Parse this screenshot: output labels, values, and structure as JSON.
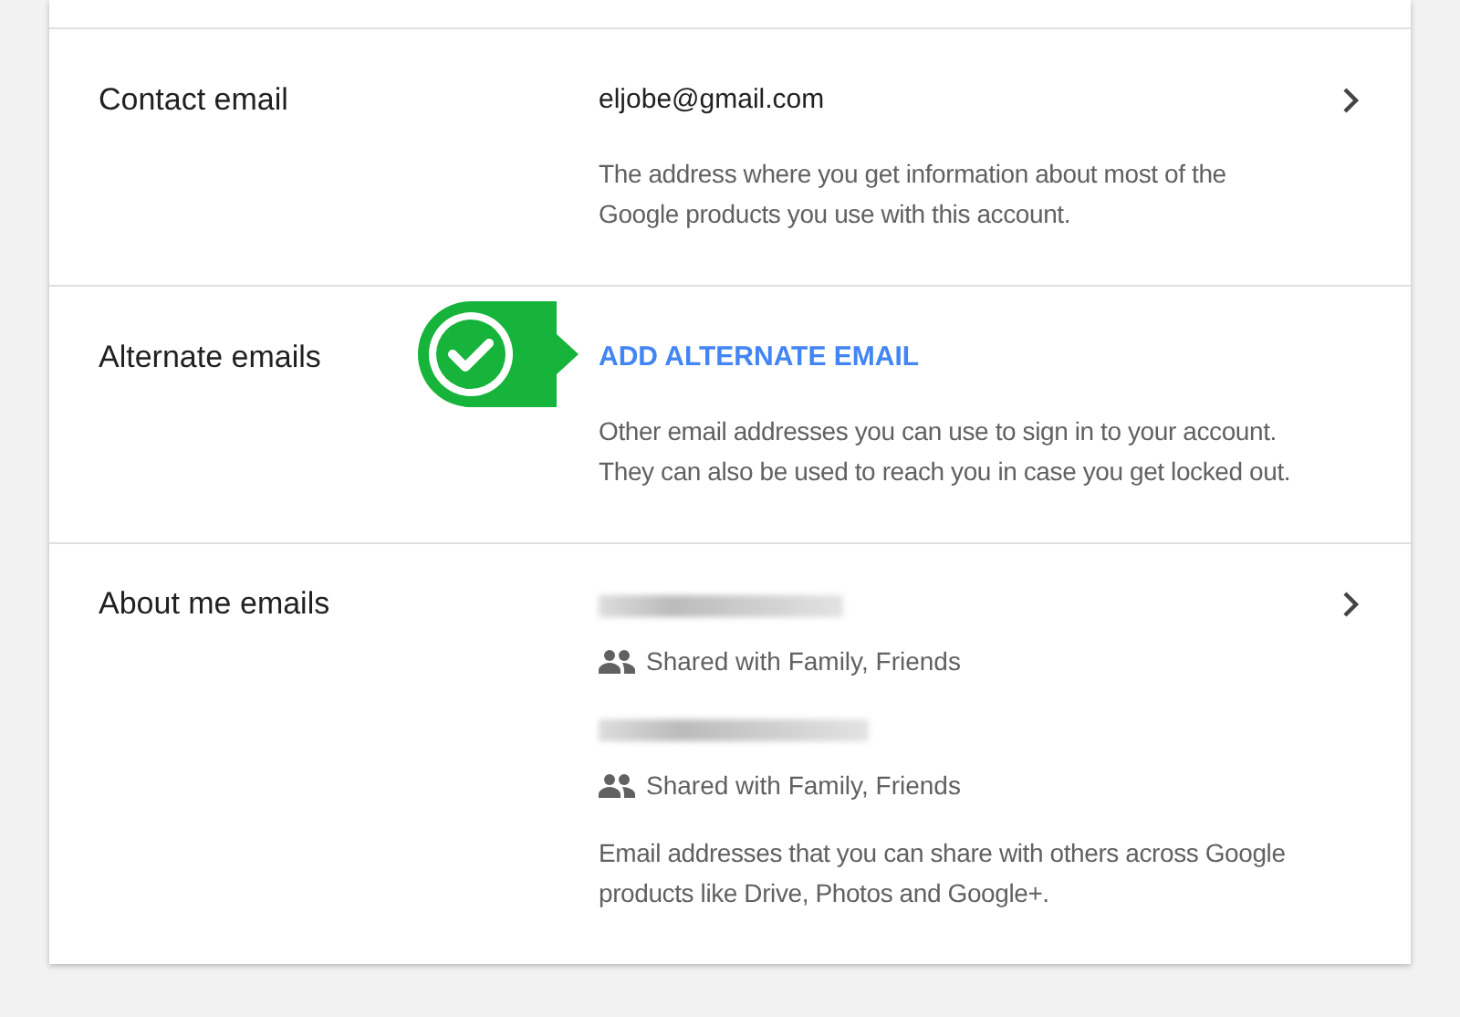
{
  "sections": [
    {
      "kind": "value",
      "label": "Contact email",
      "value": "eljobe@gmail.com",
      "description": "The address where you get information about most of the Google products you use with this account.",
      "chevron": true,
      "callout": false
    },
    {
      "kind": "action",
      "label": "Alternate emails",
      "action": "ADD ALTERNATE EMAIL",
      "description": "Other email addresses you can use to sign in to your account. They can also be used to reach you in case you get locked out.",
      "chevron": false,
      "callout": true
    },
    {
      "kind": "list",
      "label": "About me emails",
      "entries": [
        {
          "sharing": "Shared with Family, Friends"
        },
        {
          "sharing": "Shared with Family, Friends"
        }
      ],
      "description": "Email addresses that you can share with others across Google products like Drive, Photos and Google+.",
      "chevron": true,
      "callout": false
    }
  ]
}
